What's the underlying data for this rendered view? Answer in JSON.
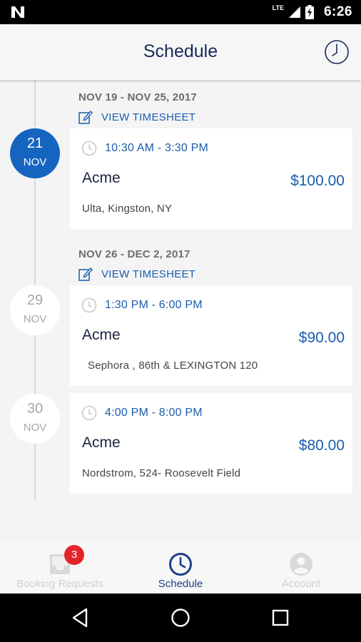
{
  "status_bar": {
    "network": "LTE",
    "time": "6:26"
  },
  "app_bar": {
    "title": "Schedule",
    "history_icon": "clock-history-icon"
  },
  "weeks": [
    {
      "range": "NOV 19  - NOV 25, 2017",
      "timesheet_label": "VIEW TIMESHEET",
      "days": [
        {
          "day": "21",
          "month": "NOV",
          "selected": true,
          "shift": {
            "time_range": "10:30 AM - 3:30 PM",
            "company": "Acme",
            "amount": "$100.00",
            "location": "Ulta, Kingston, NY"
          }
        }
      ]
    },
    {
      "range": "NOV 26  - DEC 2, 2017",
      "timesheet_label": "VIEW TIMESHEET",
      "days": [
        {
          "day": "29",
          "month": "NOV",
          "selected": false,
          "shift": {
            "time_range": "1:30 PM - 6:00 PM",
            "company": "Acme",
            "amount": "$90.00",
            "location": "Sephora , 86th & LEXINGTON 120"
          }
        },
        {
          "day": "30",
          "month": "NOV",
          "selected": false,
          "shift": {
            "time_range": "4:00 PM - 8:00 PM",
            "company": "Acme",
            "amount": "$80.00",
            "location": "Nordstrom, 524- Roosevelt Field"
          }
        }
      ]
    }
  ],
  "bottom_nav": {
    "items": [
      {
        "label": "Booking Requests",
        "icon": "inbox-icon",
        "badge": "3",
        "active": false
      },
      {
        "label": "Schedule",
        "icon": "clock-icon",
        "active": true
      },
      {
        "label": "Account",
        "icon": "account-icon",
        "active": false
      }
    ]
  },
  "colors": {
    "primary": "#1565c0",
    "link": "#1a5dad",
    "title": "#162a5a",
    "badge": "#e4242b"
  }
}
